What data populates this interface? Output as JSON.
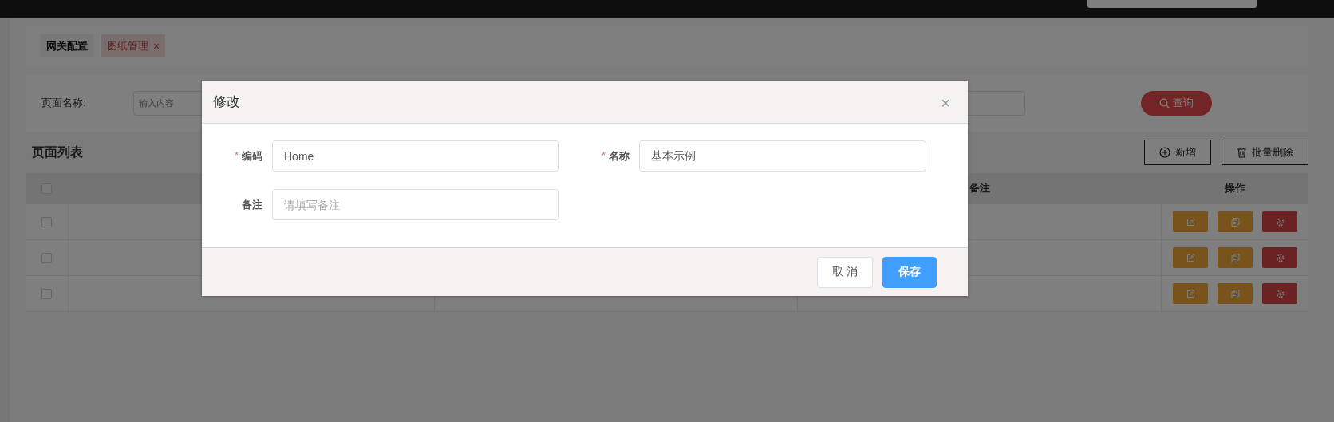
{
  "tags": [
    {
      "label": "网关配置",
      "selected": false
    },
    {
      "label": "图纸管理",
      "selected": true,
      "close": "×"
    }
  ],
  "search": {
    "label": "页面名称:",
    "placeholder": "输入内容",
    "button": "查询"
  },
  "list": {
    "title": "页面列表",
    "buttons": [
      {
        "kind": "add",
        "label": "新增"
      },
      {
        "kind": "delete",
        "label": "批量删除"
      }
    ],
    "columns": [
      {},
      {},
      {
        "label": "备注"
      },
      {
        "label": "操作"
      }
    ],
    "header_checked": false,
    "rows": [
      {
        "checked": false
      },
      {
        "checked": false
      },
      {
        "checked": false
      }
    ]
  },
  "dialog": {
    "title": "修改",
    "close": "×",
    "fields": [
      {
        "label": "编码",
        "mark": "*",
        "value": "Home"
      },
      {
        "label": "名称",
        "mark": "*",
        "value": "基本示例"
      },
      {
        "label": "备注",
        "placeholder": "请填写备注"
      }
    ],
    "buttons": [
      {
        "kind": "secondary",
        "label": "取 消"
      },
      {
        "kind": "primary",
        "label": "保存"
      }
    ]
  }
}
